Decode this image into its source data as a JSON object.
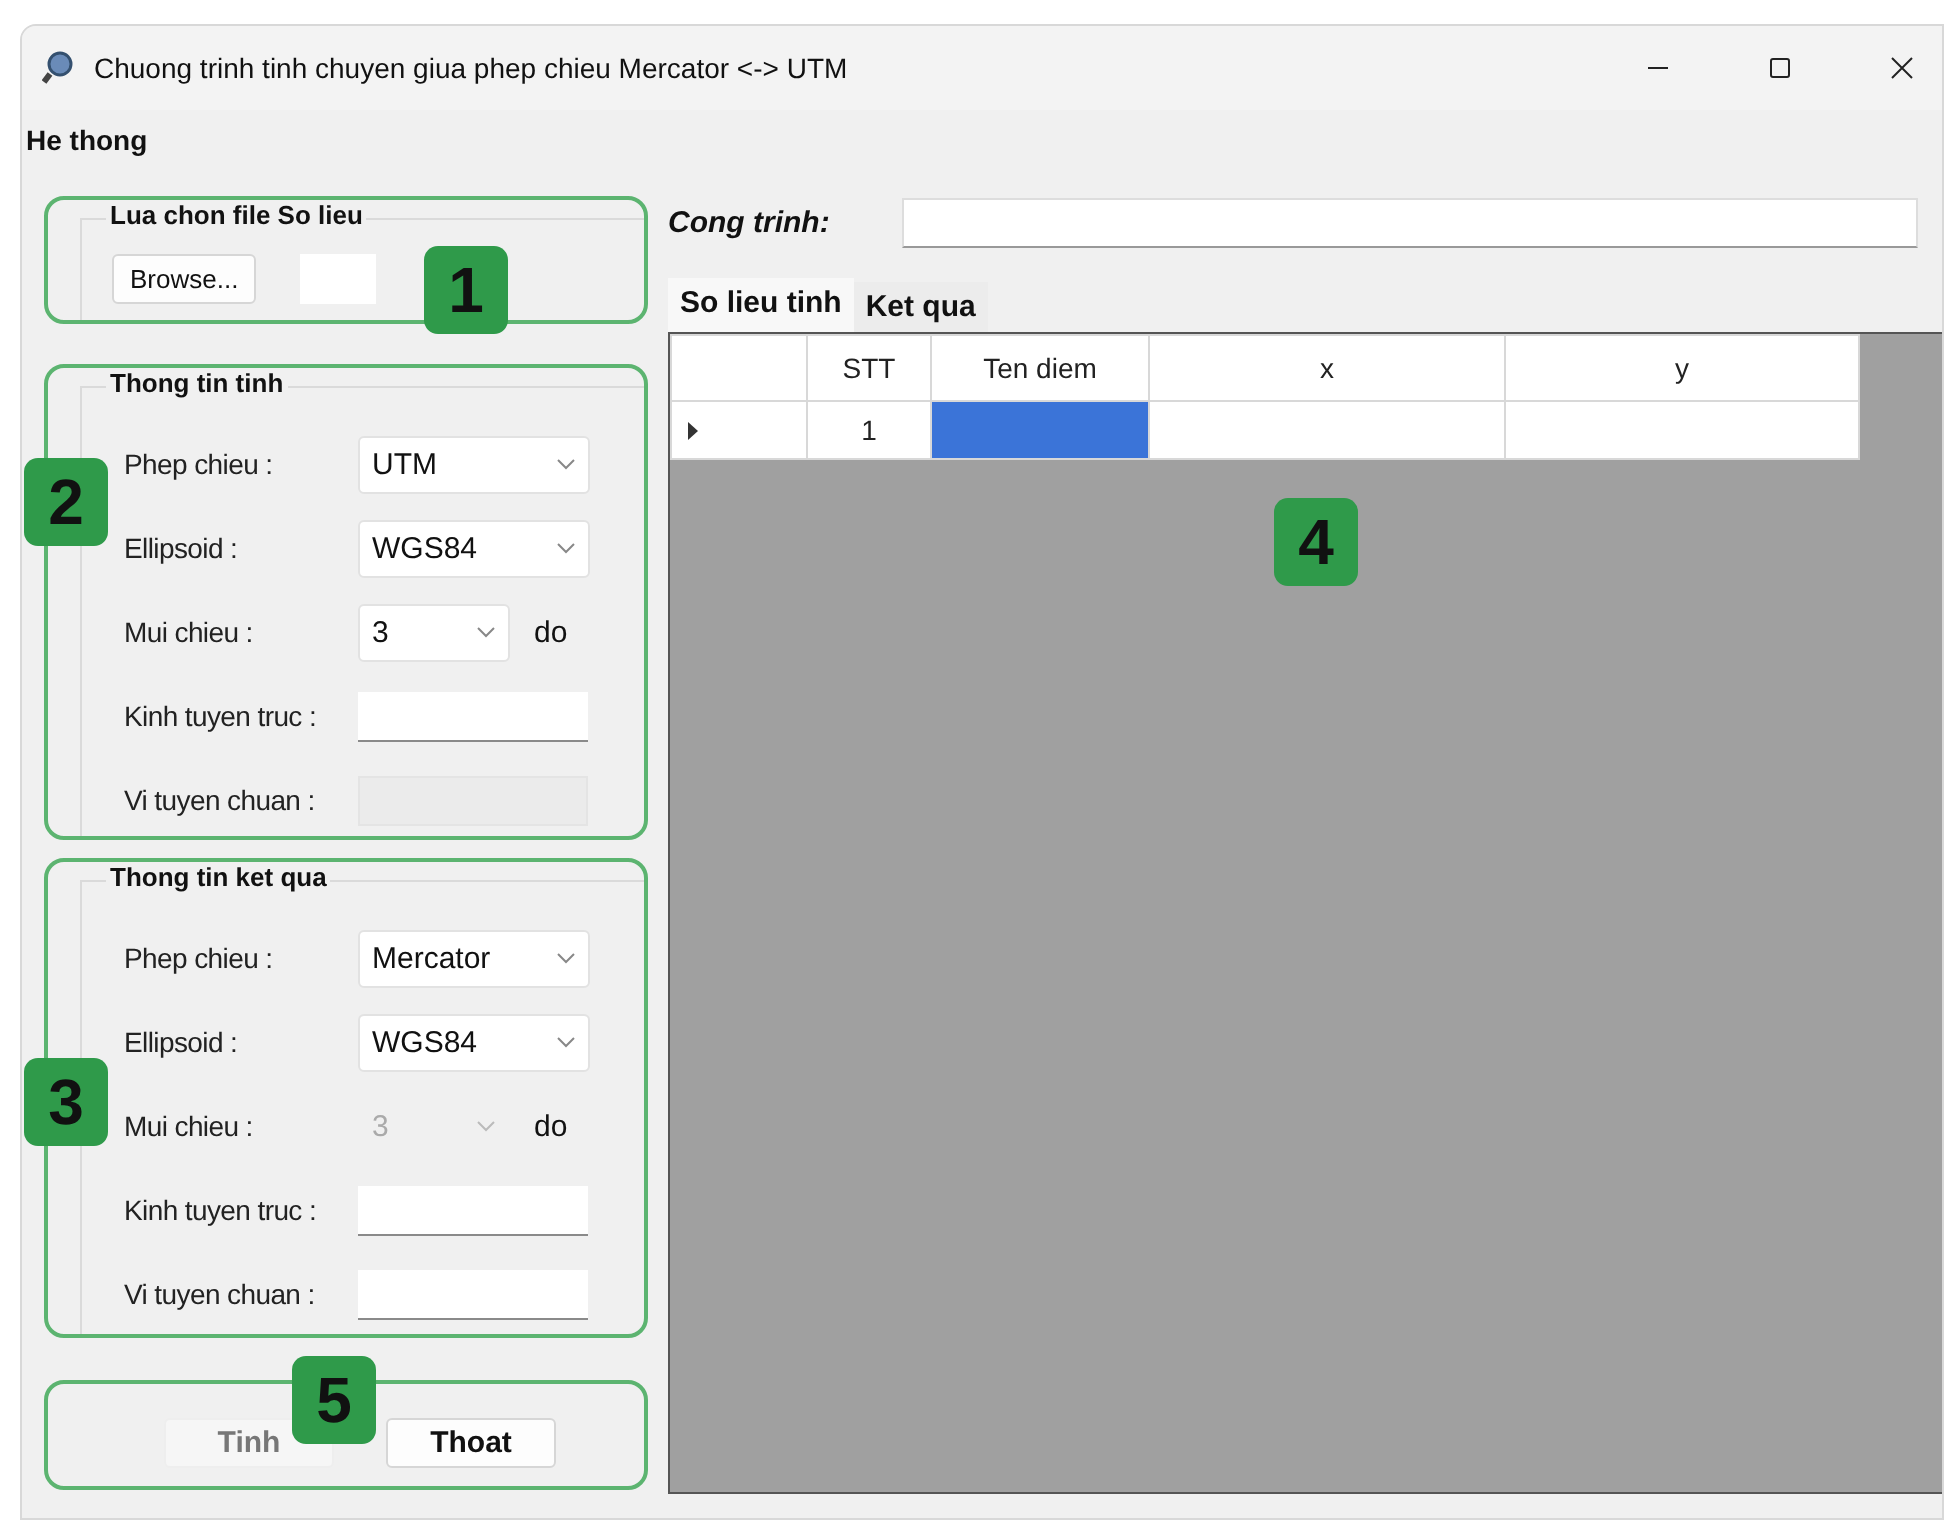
{
  "window": {
    "title": "Chuong trinh tinh chuyen giua phep chieu Mercator <-> UTM"
  },
  "menu": [
    {
      "label": "He thong"
    }
  ],
  "file_group": {
    "callout": "1",
    "title": "Lua chon file So lieu",
    "browse_button": "Browse..."
  },
  "input_group": {
    "callout": "2",
    "title": "Thong tin tinh",
    "rows": [
      {
        "kind": "combo",
        "label": "Phep chieu :",
        "value": "UTM",
        "disabled": false
      },
      {
        "kind": "combo",
        "label": "Ellipsoid :",
        "value": "WGS84",
        "disabled": false
      },
      {
        "kind": "combo",
        "label": "Mui chieu :",
        "value": "3",
        "disabled": false,
        "unit": "do"
      },
      {
        "kind": "text",
        "label": "Kinh tuyen truc :",
        "disabled": false
      },
      {
        "kind": "text",
        "label": "Vi tuyen chuan :",
        "disabled": true
      }
    ]
  },
  "output_group": {
    "callout": "3",
    "title": "Thong tin ket qua",
    "rows": [
      {
        "kind": "combo",
        "label": "Phep chieu :",
        "value": "Mercator",
        "disabled": false
      },
      {
        "kind": "combo",
        "label": "Ellipsoid :",
        "value": "WGS84",
        "disabled": false
      },
      {
        "kind": "combo",
        "label": "Mui chieu :",
        "value": "3",
        "disabled": true,
        "unit": "do"
      },
      {
        "kind": "text",
        "label": "Kinh tuyen truc :",
        "disabled": false
      },
      {
        "kind": "text",
        "label": "Vi tuyen chuan :",
        "disabled": false
      }
    ]
  },
  "actions": {
    "callout": "5",
    "buttons": [
      {
        "label": "Tinh",
        "disabled": true
      },
      {
        "label": "Thoat",
        "disabled": false
      }
    ]
  },
  "project": {
    "label": "Cong trinh:"
  },
  "tabs": [
    {
      "label": "So lieu tinh",
      "selected": true
    },
    {
      "label": "Ket qua",
      "selected": false
    }
  ],
  "grid": {
    "callout": "4",
    "columns": [
      "STT",
      "Ten diem",
      "x",
      "y"
    ],
    "rows": [
      {
        "current": true,
        "cells": [
          {
            "text": "1",
            "selected": false
          },
          {
            "selected": true
          },
          {
            "selected": false
          },
          {
            "selected": false
          }
        ]
      }
    ]
  }
}
